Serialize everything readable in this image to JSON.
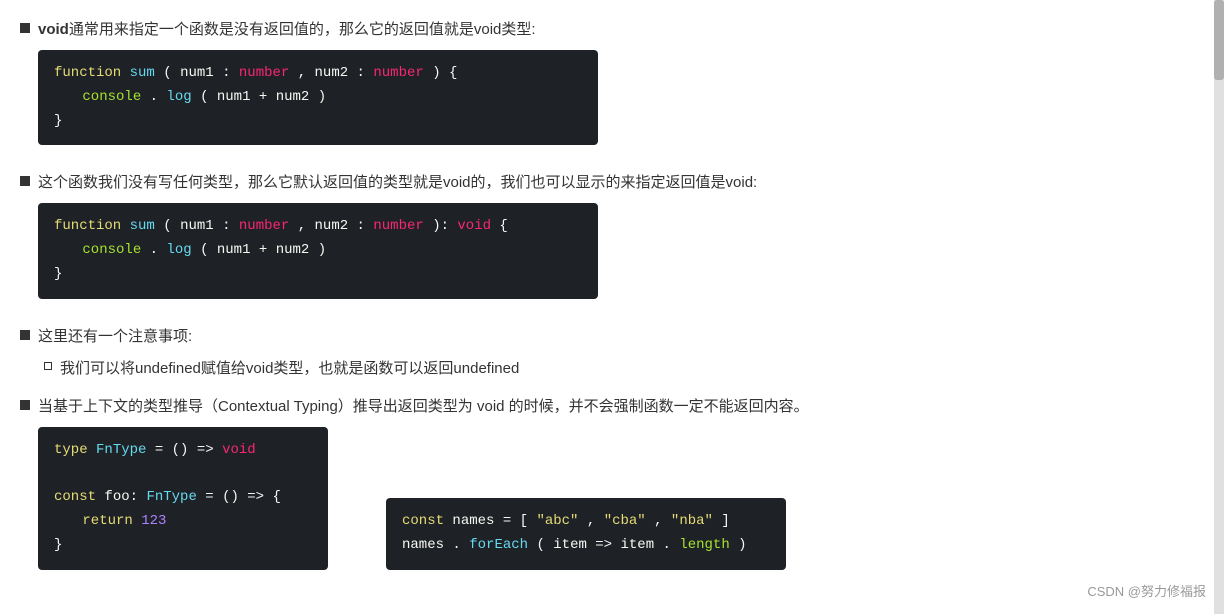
{
  "sections": [
    {
      "id": "s1",
      "bullet": "square",
      "title_parts": [
        {
          "text": "void",
          "bold": true,
          "code": false
        },
        {
          "text": "通常用来指定一个函数是没有返回值的，那么它的返回值就是void类型:",
          "bold": false,
          "code": false
        }
      ],
      "code_blocks": [
        {
          "id": "cb1",
          "lines": [
            {
              "tokens": [
                {
                  "text": "function",
                  "cls": "kw"
                },
                {
                  "text": " ",
                  "cls": "plain"
                },
                {
                  "text": "sum",
                  "cls": "fn"
                },
                {
                  "text": "(",
                  "cls": "punc"
                },
                {
                  "text": "num1",
                  "cls": "param"
                },
                {
                  "text": ": ",
                  "cls": "colon"
                },
                {
                  "text": "number",
                  "cls": "type-kw"
                },
                {
                  "text": ", ",
                  "cls": "punc"
                },
                {
                  "text": "num2",
                  "cls": "param"
                },
                {
                  "text": ": ",
                  "cls": "colon"
                },
                {
                  "text": "number",
                  "cls": "type-kw"
                },
                {
                  "text": ") {",
                  "cls": "punc"
                }
              ]
            },
            {
              "tokens": [
                {
                  "text": "  ",
                  "cls": "indent"
                },
                {
                  "text": "console",
                  "cls": "console"
                },
                {
                  "text": ".",
                  "cls": "punc"
                },
                {
                  "text": "log",
                  "cls": "log"
                },
                {
                  "text": "(",
                  "cls": "punc"
                },
                {
                  "text": "num1",
                  "cls": "param"
                },
                {
                  "text": " + ",
                  "cls": "punc"
                },
                {
                  "text": "num2",
                  "cls": "param"
                },
                {
                  "text": ")",
                  "cls": "punc"
                }
              ]
            },
            {
              "tokens": [
                {
                  "text": "}",
                  "cls": "punc"
                }
              ]
            }
          ]
        }
      ]
    },
    {
      "id": "s2",
      "bullet": "square",
      "title_parts": [
        {
          "text": "这个函数我们没有写任何类型，那么它默认返回值的类型就是void的，我们也可以显示的来指定返回值是void:",
          "bold": false,
          "code": false
        }
      ],
      "code_blocks": [
        {
          "id": "cb2",
          "lines": [
            {
              "tokens": [
                {
                  "text": "function",
                  "cls": "kw"
                },
                {
                  "text": " ",
                  "cls": "plain"
                },
                {
                  "text": "sum",
                  "cls": "fn"
                },
                {
                  "text": "(",
                  "cls": "punc"
                },
                {
                  "text": "num1",
                  "cls": "param"
                },
                {
                  "text": ": ",
                  "cls": "colon"
                },
                {
                  "text": "number",
                  "cls": "type-kw"
                },
                {
                  "text": ", ",
                  "cls": "punc"
                },
                {
                  "text": "num2",
                  "cls": "param"
                },
                {
                  "text": ": ",
                  "cls": "colon"
                },
                {
                  "text": "number",
                  "cls": "type-kw"
                },
                {
                  "text": "): ",
                  "cls": "punc"
                },
                {
                  "text": "void",
                  "cls": "type-kw"
                },
                {
                  "text": " {",
                  "cls": "punc"
                }
              ]
            },
            {
              "tokens": [
                {
                  "text": "  ",
                  "cls": "indent"
                },
                {
                  "text": "console",
                  "cls": "console"
                },
                {
                  "text": ".",
                  "cls": "punc"
                },
                {
                  "text": "log",
                  "cls": "log"
                },
                {
                  "text": "(",
                  "cls": "punc"
                },
                {
                  "text": "num1",
                  "cls": "param"
                },
                {
                  "text": " + ",
                  "cls": "punc"
                },
                {
                  "text": "num2",
                  "cls": "param"
                },
                {
                  "text": ")",
                  "cls": "punc"
                }
              ]
            },
            {
              "tokens": [
                {
                  "text": "}",
                  "cls": "punc"
                }
              ]
            }
          ]
        }
      ]
    },
    {
      "id": "s3",
      "bullet": "square",
      "title_parts": [
        {
          "text": "这里还有一个注意事项:",
          "bold": false,
          "code": false
        }
      ],
      "sub_items": [
        {
          "bullet": "small",
          "text": "我们可以将undefined赋值给void类型，也就是函数可以返回undefined"
        }
      ]
    },
    {
      "id": "s4",
      "bullet": "square",
      "title_parts": [
        {
          "text": "当基于上下文的类型推导（Contextual Typing）推导出返回类型为 void 的时候，并不会强制函数一定不能返回内容。",
          "bold": false,
          "code": false
        }
      ],
      "bottom_blocks": [
        {
          "id": "cb3",
          "narrow": true,
          "lines": [
            {
              "tokens": [
                {
                  "text": "type",
                  "cls": "kw"
                },
                {
                  "text": " ",
                  "cls": "plain"
                },
                {
                  "text": "FnType",
                  "cls": "fn"
                },
                {
                  "text": " = () => ",
                  "cls": "plain"
                },
                {
                  "text": "void",
                  "cls": "type-kw"
                }
              ]
            },
            {
              "tokens": []
            },
            {
              "tokens": [
                {
                  "text": "const",
                  "cls": "kw"
                },
                {
                  "text": " foo: ",
                  "cls": "plain"
                },
                {
                  "text": "FnType",
                  "cls": "fn"
                },
                {
                  "text": " = () => {",
                  "cls": "plain"
                }
              ]
            },
            {
              "tokens": [
                {
                  "text": "  ",
                  "cls": "indent"
                },
                {
                  "text": "return",
                  "cls": "return-kw"
                },
                {
                  "text": " ",
                  "cls": "plain"
                },
                {
                  "text": "123",
                  "cls": "num"
                }
              ]
            },
            {
              "tokens": [
                {
                  "text": "}",
                  "cls": "punc"
                }
              ]
            }
          ]
        },
        {
          "id": "cb4",
          "narrow": false,
          "lines": [
            {
              "tokens": [
                {
                  "text": "const",
                  "cls": "kw"
                },
                {
                  "text": " names = [",
                  "cls": "plain"
                },
                {
                  "text": "\"abc\"",
                  "cls": "str"
                },
                {
                  "text": ", ",
                  "cls": "plain"
                },
                {
                  "text": "\"cba\"",
                  "cls": "str"
                },
                {
                  "text": ", ",
                  "cls": "plain"
                },
                {
                  "text": "\"nba\"",
                  "cls": "str"
                },
                {
                  "text": "]",
                  "cls": "plain"
                }
              ]
            },
            {
              "tokens": [
                {
                  "text": "names",
                  "cls": "plain"
                },
                {
                  "text": ".",
                  "cls": "plain"
                },
                {
                  "text": "forEach",
                  "cls": "method"
                },
                {
                  "text": "(",
                  "cls": "plain"
                },
                {
                  "text": "item",
                  "cls": "param"
                },
                {
                  "text": " => ",
                  "cls": "plain"
                },
                {
                  "text": "item",
                  "cls": "param"
                },
                {
                  "text": ".",
                  "cls": "plain"
                },
                {
                  "text": "length",
                  "cls": "prop"
                },
                {
                  "text": ")",
                  "cls": "plain"
                }
              ]
            }
          ]
        }
      ]
    }
  ],
  "watermark": "CSDN @努力修福报"
}
